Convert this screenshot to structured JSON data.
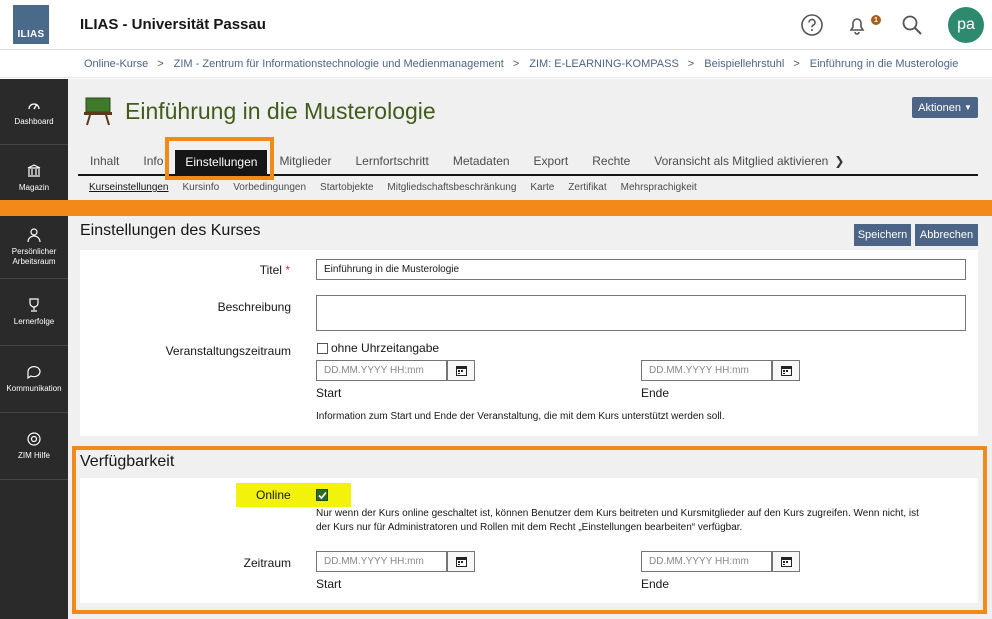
{
  "header": {
    "logo_text": "ILIAS",
    "site_title": "ILIAS - Universität Passau",
    "notification_count": "1",
    "avatar_initials": "pa"
  },
  "breadcrumb": [
    "Online-Kurse",
    "ZIM - Zentrum für Informationstechnologie und Medienmanagement",
    "ZIM: E-LEARNING-KOMPASS",
    "Beispiellehrstuhl",
    "Einführung in die Musterologie"
  ],
  "sidebar": {
    "items": [
      {
        "label": "Dashboard",
        "icon": "dashboard-icon"
      },
      {
        "label": "Magazin",
        "icon": "magazine-icon"
      },
      {
        "label": "Persönlicher Arbeitsraum",
        "icon": "user-icon"
      },
      {
        "label": "Lernerfolge",
        "icon": "trophy-icon"
      },
      {
        "label": "Kommunikation",
        "icon": "chat-icon"
      },
      {
        "label": "ZIM Hilfe",
        "icon": "lifebuoy-icon"
      }
    ]
  },
  "course": {
    "title": "Einführung in die Musterologie",
    "actions_label": "Aktionen"
  },
  "tabs": [
    "Inhalt",
    "Info",
    "Einstellungen",
    "Mitglieder",
    "Lernfortschritt",
    "Metadaten",
    "Export",
    "Rechte",
    "Voransicht als Mitglied aktivieren"
  ],
  "active_tab": "Einstellungen",
  "subtabs": [
    "Kurseinstellungen",
    "Kursinfo",
    "Vorbedingungen",
    "Startobjekte",
    "Mitgliedschaftsbeschränkung",
    "Karte",
    "Zertifikat",
    "Mehrsprachigkeit"
  ],
  "form": {
    "section_title": "Einstellungen des Kurses",
    "save_label": "Speichern",
    "cancel_label": "Abbrechen",
    "title_label": "Titel",
    "required_marker": "*",
    "title_value": "Einführung in die Musterologie",
    "description_label": "Beschreibung",
    "period_label": "Veranstaltungszeitraum",
    "no_time_label": "ohne Uhrzeitangabe",
    "date_placeholder": "DD.MM.YYYY HH:mm",
    "start_label": "Start",
    "end_label": "Ende",
    "period_info": "Information zum Start und Ende der Veranstaltung, die mit dem Kurs unterstützt werden soll."
  },
  "availability": {
    "section_title": "Verfügbarkeit",
    "online_label": "Online",
    "online_checked": true,
    "online_info_line1": "Nur wenn der Kurs online geschaltet ist, können Benutzer dem Kurs beitreten und Kursmitglieder auf den Kurs zugreifen. Wenn nicht, ist",
    "online_info_line2": "der Kurs nur für Administratoren und Rollen mit dem Recht „Einstellungen bearbeiten“ verfügbar.",
    "period_label": "Zeitraum",
    "date_placeholder": "DD.MM.YYYY HH:mm",
    "start_label": "Start",
    "end_label": "Ende"
  },
  "colors": {
    "accent_orange": "#f28a1a",
    "button_blue": "#4c6586",
    "highlight_yellow": "#f2f20a",
    "title_green": "#3f5c1b"
  }
}
